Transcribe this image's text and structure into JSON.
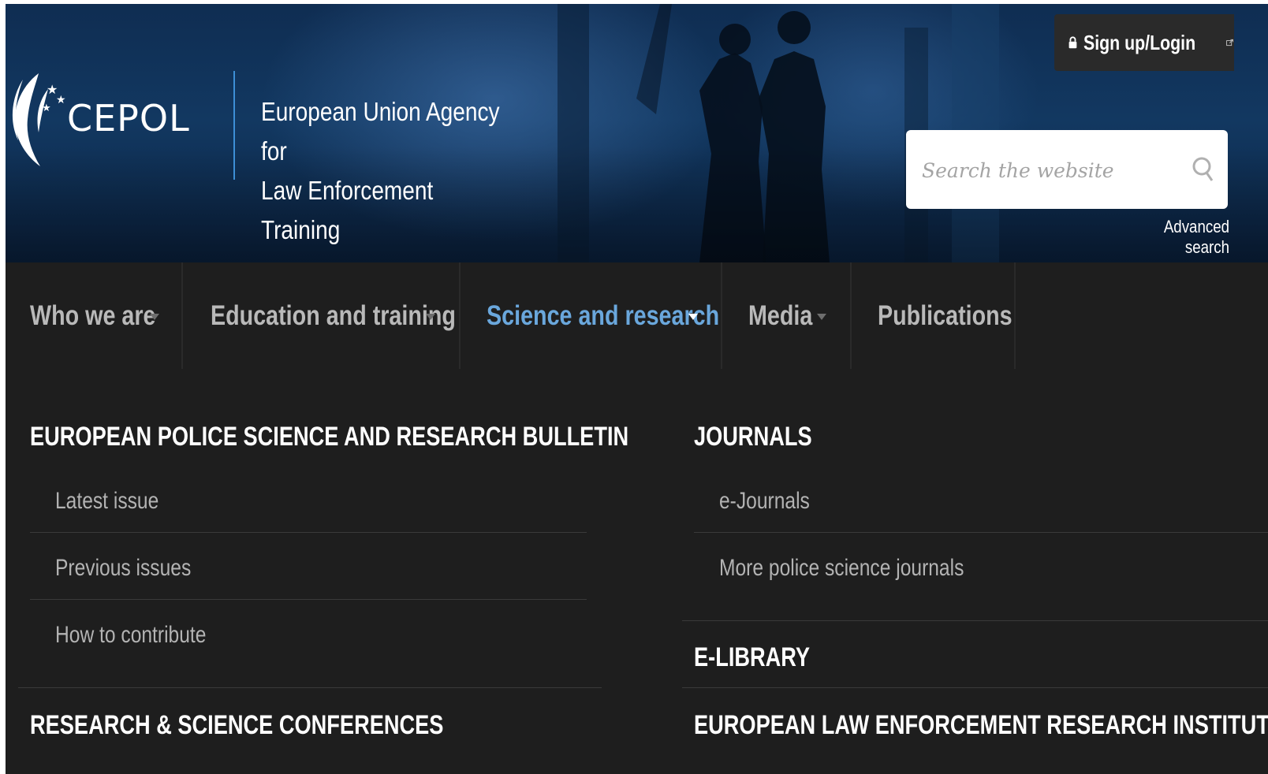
{
  "header": {
    "logo_text": "CEPOL",
    "agency_name_line1": "European Union Agency for",
    "agency_name_line2": "Law Enforcement Training",
    "login_label": "Sign up/Login",
    "search_placeholder": "Search the website",
    "advanced_search_label": "Advanced search"
  },
  "nav": {
    "items": [
      {
        "label": "Who we are",
        "has_dropdown": true,
        "active": false
      },
      {
        "label": "Education and training",
        "has_dropdown": true,
        "active": false
      },
      {
        "label": "Science and research",
        "has_dropdown": true,
        "active": true
      },
      {
        "label": "Media",
        "has_dropdown": true,
        "active": false
      },
      {
        "label": "Publications",
        "has_dropdown": false,
        "active": false
      }
    ]
  },
  "menu": {
    "left": {
      "heading1": "EUROPEAN POLICE SCIENCE AND RESEARCH BULLETIN",
      "items": [
        "Latest issue",
        "Previous issues",
        "How to contribute"
      ],
      "heading2": "RESEARCH & SCIENCE CONFERENCES"
    },
    "right": {
      "heading1": "JOURNALS",
      "items": [
        "e-Journals",
        "More police science journals"
      ],
      "heading2": "E-LIBRARY",
      "heading3": "EUROPEAN LAW ENFORCEMENT RESEARCH INSTITUTIONS"
    }
  },
  "colors": {
    "header_bg": "#123861",
    "nav_bg": "#1e1e1e",
    "active_nav": "#6aa7dc",
    "nav_text": "#b9b9b9",
    "divider_accent": "#3d8fd6"
  }
}
